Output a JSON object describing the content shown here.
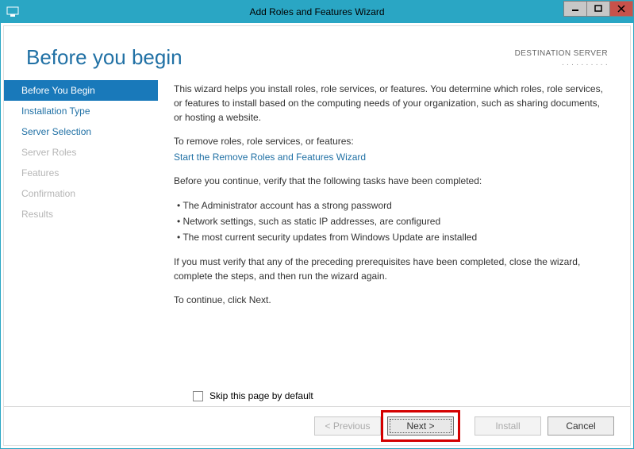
{
  "window": {
    "title": "Add Roles and Features Wizard"
  },
  "header": {
    "heading": "Before you begin",
    "dest_label": "DESTINATION SERVER",
    "dest_name": "· · · · · · · · · ·"
  },
  "sidebar": {
    "items": [
      {
        "label": "Before You Begin",
        "state": "active"
      },
      {
        "label": "Installation Type",
        "state": "enabled"
      },
      {
        "label": "Server Selection",
        "state": "enabled"
      },
      {
        "label": "Server Roles",
        "state": "disabled"
      },
      {
        "label": "Features",
        "state": "disabled"
      },
      {
        "label": "Confirmation",
        "state": "disabled"
      },
      {
        "label": "Results",
        "state": "disabled"
      }
    ]
  },
  "main": {
    "p1": "This wizard helps you install roles, role services, or features. You determine which roles, role services, or features to install based on the computing needs of your organization, such as sharing documents, or hosting a website.",
    "p2": "To remove roles, role services, or features:",
    "link1": "Start the Remove Roles and Features Wizard",
    "p3": "Before you continue, verify that the following tasks have been completed:",
    "bullets": [
      "The Administrator account has a strong password",
      "Network settings, such as static IP addresses, are configured",
      "The most current security updates from Windows Update are installed"
    ],
    "p4": "If you must verify that any of the preceding prerequisites have been completed, close the wizard, complete the steps, and then run the wizard again.",
    "p5": "To continue, click Next.",
    "skip_label": "Skip this page by default"
  },
  "footer": {
    "previous": "< Previous",
    "next": "Next >",
    "install": "Install",
    "cancel": "Cancel"
  }
}
